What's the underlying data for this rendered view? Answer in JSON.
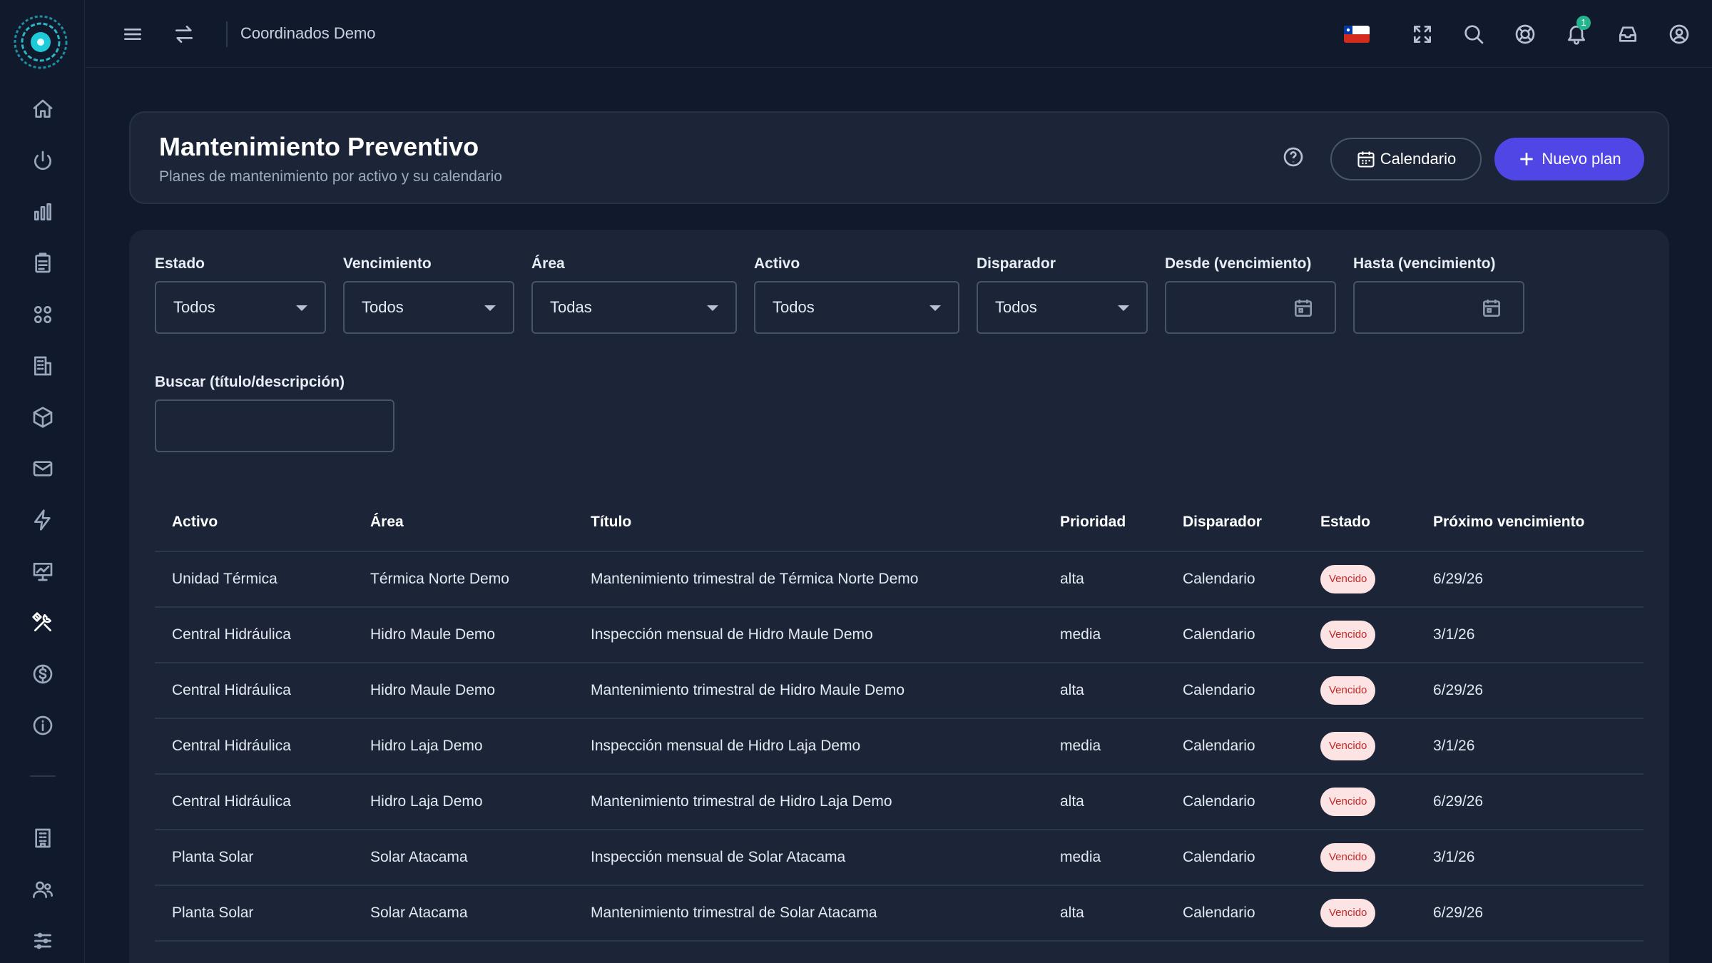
{
  "topbar": {
    "org_name": "Coordinados Demo",
    "notification_count": "1"
  },
  "header": {
    "title": "Mantenimiento Preventivo",
    "subtitle": "Planes de mantenimiento por activo y su calendario",
    "calendar_button": "Calendario",
    "new_plan_button": "Nuevo plan"
  },
  "filters": {
    "estado": {
      "label": "Estado",
      "value": "Todos"
    },
    "vencimiento": {
      "label": "Vencimiento",
      "value": "Todos"
    },
    "area": {
      "label": "Área",
      "value": "Todas"
    },
    "activo": {
      "label": "Activo",
      "value": "Todos"
    },
    "disparador": {
      "label": "Disparador",
      "value": "Todos"
    },
    "desde": {
      "label": "Desde (vencimiento)"
    },
    "hasta": {
      "label": "Hasta (vencimiento)"
    },
    "buscar": {
      "label": "Buscar (título/descripción)"
    }
  },
  "table": {
    "headers": {
      "activo": "Activo",
      "area": "Área",
      "titulo": "Título",
      "prioridad": "Prioridad",
      "disparador": "Disparador",
      "estado": "Estado",
      "proximo": "Próximo vencimiento"
    },
    "rows": [
      {
        "activo": "Unidad Térmica",
        "area": "Térmica Norte Demo",
        "titulo": "Mantenimiento trimestral de Térmica Norte Demo",
        "prioridad": "alta",
        "disparador": "Calendario",
        "estado": "Vencido",
        "proximo": "6/29/26"
      },
      {
        "activo": "Central Hidráulica",
        "area": "Hidro Maule Demo",
        "titulo": "Inspección mensual de Hidro Maule Demo",
        "prioridad": "media",
        "disparador": "Calendario",
        "estado": "Vencido",
        "proximo": "3/1/26"
      },
      {
        "activo": "Central Hidráulica",
        "area": "Hidro Maule Demo",
        "titulo": "Mantenimiento trimestral de Hidro Maule Demo",
        "prioridad": "alta",
        "disparador": "Calendario",
        "estado": "Vencido",
        "proximo": "6/29/26"
      },
      {
        "activo": "Central Hidráulica",
        "area": "Hidro Laja Demo",
        "titulo": "Inspección mensual de Hidro Laja Demo",
        "prioridad": "media",
        "disparador": "Calendario",
        "estado": "Vencido",
        "proximo": "3/1/26"
      },
      {
        "activo": "Central Hidráulica",
        "area": "Hidro Laja Demo",
        "titulo": "Mantenimiento trimestral de Hidro Laja Demo",
        "prioridad": "alta",
        "disparador": "Calendario",
        "estado": "Vencido",
        "proximo": "6/29/26"
      },
      {
        "activo": "Planta Solar",
        "area": "Solar Atacama",
        "titulo": "Inspección mensual de Solar Atacama",
        "prioridad": "media",
        "disparador": "Calendario",
        "estado": "Vencido",
        "proximo": "3/1/26"
      },
      {
        "activo": "Planta Solar",
        "area": "Solar Atacama",
        "titulo": "Mantenimiento trimestral de Solar Atacama",
        "prioridad": "alta",
        "disparador": "Calendario",
        "estado": "Vencido",
        "proximo": "6/29/26"
      }
    ]
  },
  "colors": {
    "accent": "#5046e5",
    "status_bg": "#fde4e4",
    "status_text": "#c62828",
    "badge": "#23b58d"
  }
}
